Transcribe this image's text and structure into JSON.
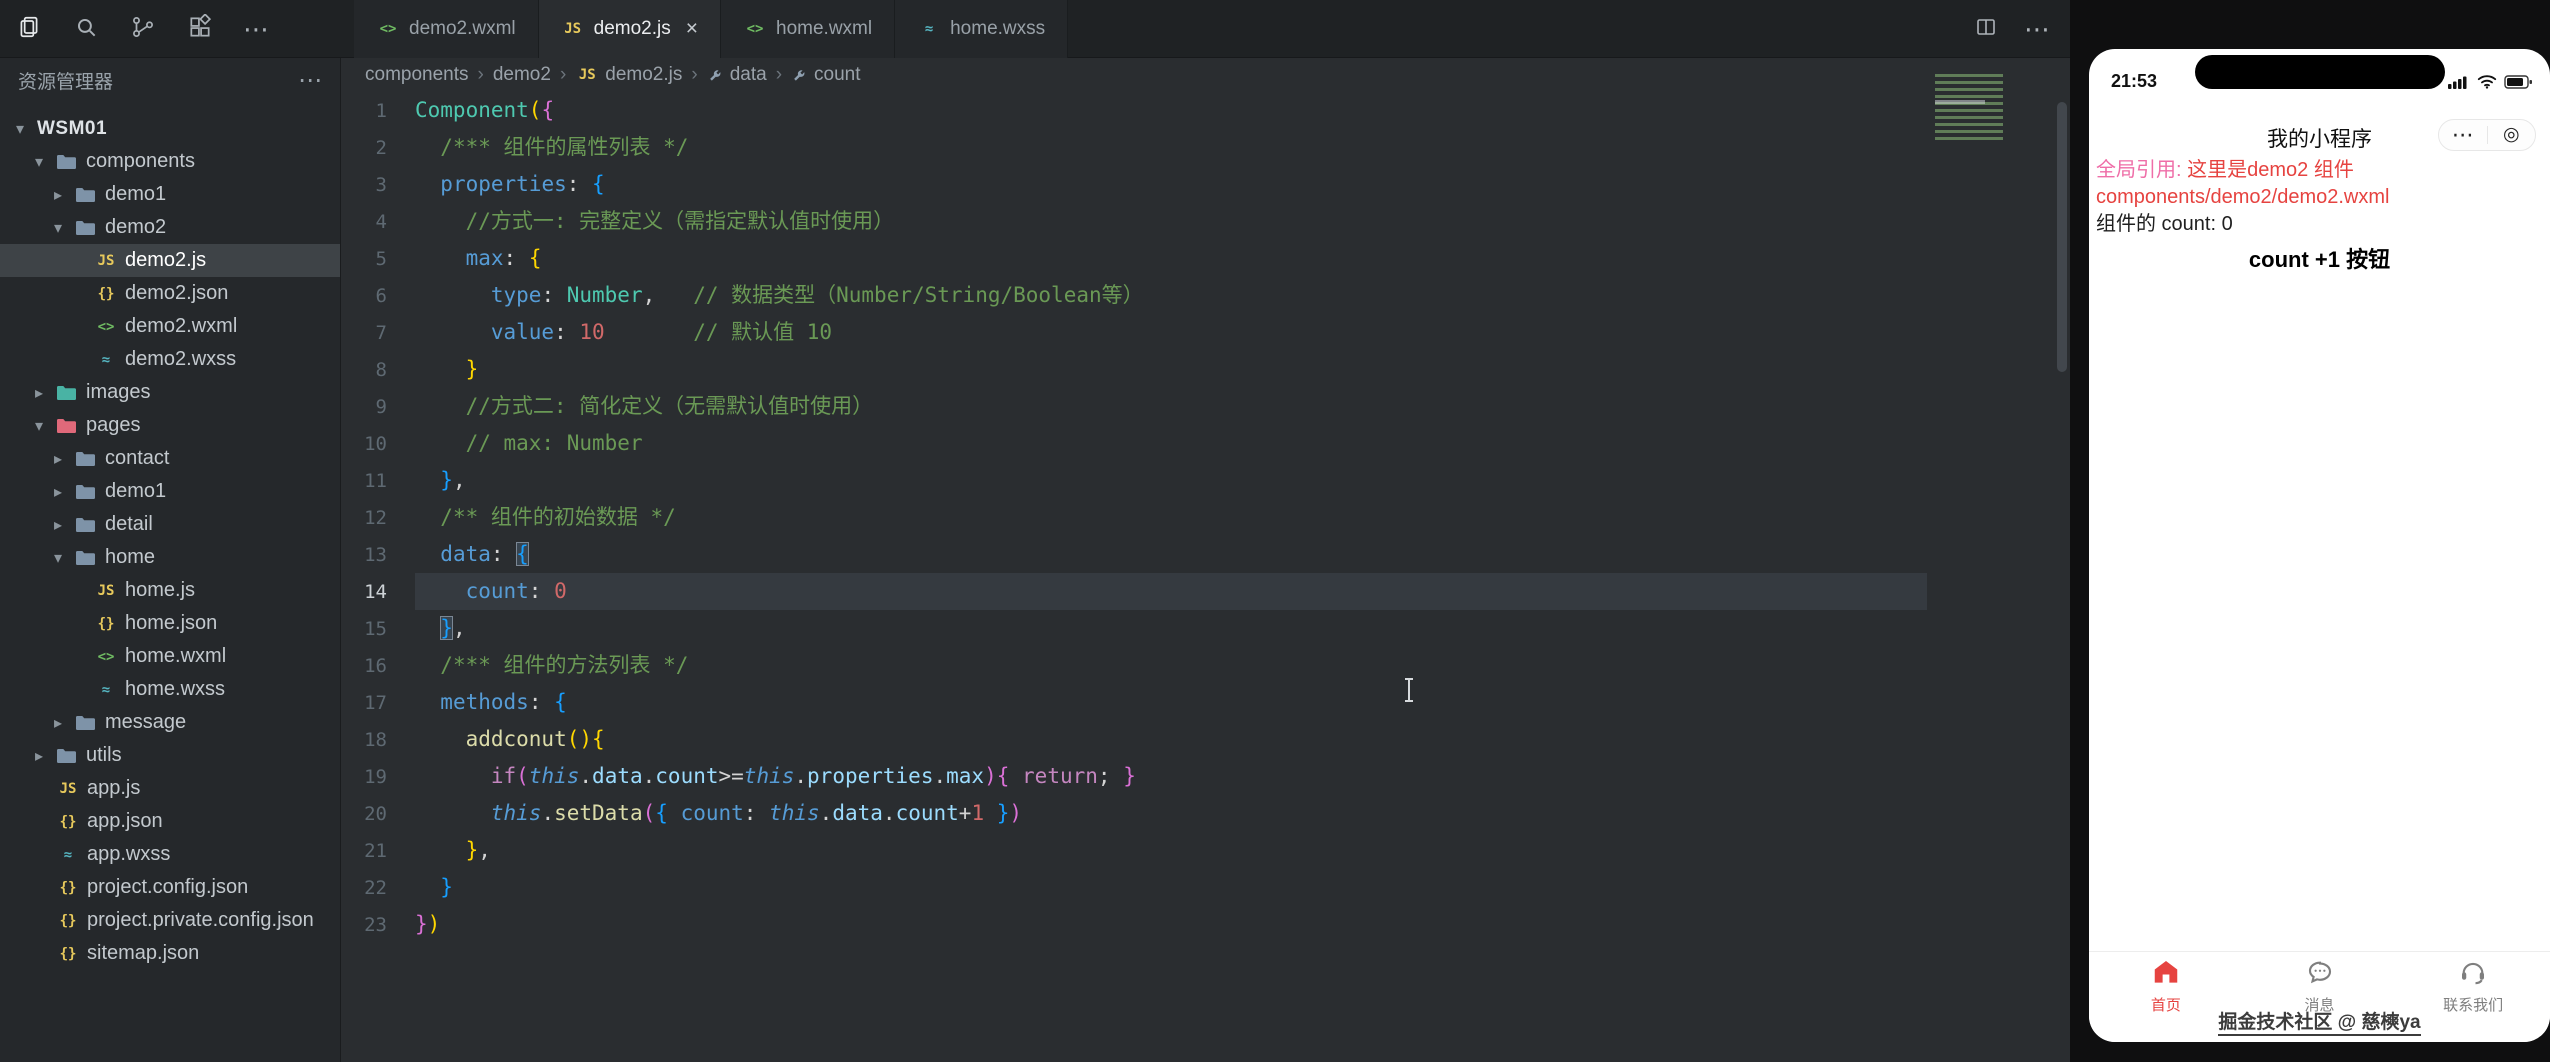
{
  "activity_bar": {
    "icons": [
      "files",
      "search",
      "git-graph",
      "extensions",
      "more"
    ],
    "more_glyph": "⋯"
  },
  "sidebar": {
    "title": "资源管理器",
    "more_label": "⋯",
    "chevron_open": "▾",
    "chevron_closed": "▸",
    "tree": [
      {
        "label": "WSM01",
        "depth": 0,
        "kind": "root",
        "state": "open"
      },
      {
        "label": "components",
        "depth": 1,
        "kind": "folder",
        "state": "open",
        "color": "#7e93a8"
      },
      {
        "label": "demo1",
        "depth": 2,
        "kind": "folder",
        "state": "closed",
        "color": "#7e93a8"
      },
      {
        "label": "demo2",
        "depth": 2,
        "kind": "folder",
        "state": "open",
        "color": "#7e93a8"
      },
      {
        "label": "demo2.js",
        "depth": 3,
        "kind": "file",
        "icon": "js",
        "selected": true
      },
      {
        "label": "demo2.json",
        "depth": 3,
        "kind": "file",
        "icon": "json"
      },
      {
        "label": "demo2.wxml",
        "depth": 3,
        "kind": "file",
        "icon": "wxml"
      },
      {
        "label": "demo2.wxss",
        "depth": 3,
        "kind": "file",
        "icon": "wxss"
      },
      {
        "label": "images",
        "depth": 1,
        "kind": "folder",
        "state": "closed",
        "color": "#49b3a4"
      },
      {
        "label": "pages",
        "depth": 1,
        "kind": "folder",
        "state": "open",
        "color": "#e0697a"
      },
      {
        "label": "contact",
        "depth": 2,
        "kind": "folder",
        "state": "closed",
        "color": "#7e93a8"
      },
      {
        "label": "demo1",
        "depth": 2,
        "kind": "folder",
        "state": "closed",
        "color": "#7e93a8"
      },
      {
        "label": "detail",
        "depth": 2,
        "kind": "folder",
        "state": "closed",
        "color": "#7e93a8"
      },
      {
        "label": "home",
        "depth": 2,
        "kind": "folder",
        "state": "open",
        "color": "#7e93a8"
      },
      {
        "label": "home.js",
        "depth": 3,
        "kind": "file",
        "icon": "js"
      },
      {
        "label": "home.json",
        "depth": 3,
        "kind": "file",
        "icon": "json"
      },
      {
        "label": "home.wxml",
        "depth": 3,
        "kind": "file",
        "icon": "wxml"
      },
      {
        "label": "home.wxss",
        "depth": 3,
        "kind": "file",
        "icon": "wxss"
      },
      {
        "label": "message",
        "depth": 2,
        "kind": "folder",
        "state": "closed",
        "color": "#7e93a8"
      },
      {
        "label": "utils",
        "depth": 1,
        "kind": "folder",
        "state": "closed",
        "color": "#7e93a8"
      },
      {
        "label": "app.js",
        "depth": 1,
        "kind": "file",
        "icon": "js"
      },
      {
        "label": "app.json",
        "depth": 1,
        "kind": "file",
        "icon": "json"
      },
      {
        "label": "app.wxss",
        "depth": 1,
        "kind": "file",
        "icon": "wxss"
      },
      {
        "label": "project.config.json",
        "depth": 1,
        "kind": "file",
        "icon": "json"
      },
      {
        "label": "project.private.config.json",
        "depth": 1,
        "kind": "file",
        "icon": "json"
      },
      {
        "label": "sitemap.json",
        "depth": 1,
        "kind": "file",
        "icon": "json"
      }
    ]
  },
  "file_icons": {
    "js": {
      "glyph": "JS",
      "color": "#e7c95c"
    },
    "json": {
      "glyph": "{}",
      "color": "#e7c95c"
    },
    "wxml": {
      "glyph": "<>",
      "color": "#6fba62"
    },
    "wxss": {
      "glyph": "≈",
      "color": "#56b6c2"
    }
  },
  "tabs": {
    "close_glyph": "×",
    "items": [
      {
        "label": "demo2.wxml",
        "icon": "wxml",
        "active": false
      },
      {
        "label": "demo2.js",
        "icon": "js",
        "active": true,
        "closable": true
      },
      {
        "label": "home.wxml",
        "icon": "wxml",
        "active": false
      },
      {
        "label": "home.wxss",
        "icon": "wxss",
        "active": false
      }
    ]
  },
  "editor_actions": {
    "icons": [
      "split-editor",
      "more"
    ],
    "more_glyph": "⋯"
  },
  "breadcrumb": {
    "separator": "›",
    "items": [
      {
        "label": "components"
      },
      {
        "label": "demo2"
      },
      {
        "label": "demo2.js",
        "icon": "js"
      },
      {
        "label": "data",
        "icon": "symbol"
      },
      {
        "label": "count",
        "icon": "symbol"
      }
    ]
  },
  "editor": {
    "active_line": 14,
    "lines": [
      [
        [
          "fn",
          "Component"
        ],
        [
          "b1",
          "("
        ],
        [
          "b2",
          "{"
        ]
      ],
      [
        [
          "ws",
          "  "
        ],
        [
          "c",
          "/*** 组件的属性列表 */"
        ]
      ],
      [
        [
          "ws",
          "  "
        ],
        [
          "key",
          "properties"
        ],
        [
          "pun",
          ": "
        ],
        [
          "b3",
          "{"
        ]
      ],
      [
        [
          "ws",
          "    "
        ],
        [
          "c",
          "//方式一: 完整定义（需指定默认值时使用）"
        ]
      ],
      [
        [
          "ws",
          "    "
        ],
        [
          "key",
          "max"
        ],
        [
          "pun",
          ": "
        ],
        [
          "b1",
          "{"
        ]
      ],
      [
        [
          "ws",
          "      "
        ],
        [
          "key",
          "type"
        ],
        [
          "pun",
          ": "
        ],
        [
          "type",
          "Number"
        ],
        [
          "pun",
          ","
        ],
        [
          "ws",
          "   "
        ],
        [
          "c",
          "// 数据类型（Number/String/Boolean等）"
        ]
      ],
      [
        [
          "ws",
          "      "
        ],
        [
          "key",
          "value"
        ],
        [
          "pun",
          ": "
        ],
        [
          "num",
          "10"
        ],
        [
          "ws",
          "       "
        ],
        [
          "c",
          "// 默认值 10"
        ]
      ],
      [
        [
          "ws",
          "    "
        ],
        [
          "b1",
          "}"
        ]
      ],
      [
        [
          "ws",
          "    "
        ],
        [
          "c",
          "//方式二: 简化定义（无需默认值时使用）"
        ]
      ],
      [
        [
          "ws",
          "    "
        ],
        [
          "c",
          "// max: Number"
        ]
      ],
      [
        [
          "ws",
          "  "
        ],
        [
          "b3",
          "}"
        ],
        [
          "pun",
          ","
        ]
      ],
      [
        [
          "ws",
          "  "
        ],
        [
          "c",
          "/** 组件的初始数据 */"
        ]
      ],
      [
        [
          "ws",
          "  "
        ],
        [
          "key",
          "data"
        ],
        [
          "pun",
          ": "
        ],
        [
          "b3m",
          "{"
        ]
      ],
      [
        [
          "ws",
          "    "
        ],
        [
          "key",
          "count"
        ],
        [
          "pun",
          ": "
        ],
        [
          "num",
          "0"
        ]
      ],
      [
        [
          "ws",
          "  "
        ],
        [
          "b3m",
          "}"
        ],
        [
          "pun",
          ","
        ]
      ],
      [
        [
          "ws",
          "  "
        ],
        [
          "c",
          "/*** 组件的方法列表 */"
        ]
      ],
      [
        [
          "ws",
          "  "
        ],
        [
          "key",
          "methods"
        ],
        [
          "pun",
          ": "
        ],
        [
          "b3",
          "{"
        ]
      ],
      [
        [
          "ws",
          "    "
        ],
        [
          "fn2",
          "addconut"
        ],
        [
          "b1",
          "("
        ],
        [
          "b1",
          ")"
        ],
        [
          "b1",
          "{"
        ]
      ],
      [
        [
          "ws",
          "      "
        ],
        [
          "kw",
          "if"
        ],
        [
          "b2",
          "("
        ],
        [
          "this",
          "this"
        ],
        [
          "pun",
          "."
        ],
        [
          "mem",
          "data"
        ],
        [
          "pun",
          "."
        ],
        [
          "mem",
          "count"
        ],
        [
          "op",
          ">="
        ],
        [
          "this",
          "this"
        ],
        [
          "pun",
          "."
        ],
        [
          "mem",
          "properties"
        ],
        [
          "pun",
          "."
        ],
        [
          "mem",
          "max"
        ],
        [
          "b2",
          ")"
        ],
        [
          "b2",
          "{"
        ],
        [
          "ws",
          " "
        ],
        [
          "kw",
          "return"
        ],
        [
          "pun",
          "; "
        ],
        [
          "b2",
          "}"
        ]
      ],
      [
        [
          "ws",
          "      "
        ],
        [
          "this",
          "this"
        ],
        [
          "pun",
          "."
        ],
        [
          "fn2",
          "setData"
        ],
        [
          "b2",
          "("
        ],
        [
          "b3",
          "{"
        ],
        [
          "ws",
          " "
        ],
        [
          "key",
          "count"
        ],
        [
          "pun",
          ": "
        ],
        [
          "this",
          "this"
        ],
        [
          "pun",
          "."
        ],
        [
          "mem",
          "data"
        ],
        [
          "pun",
          "."
        ],
        [
          "mem",
          "count"
        ],
        [
          "op",
          "+"
        ],
        [
          "num",
          "1"
        ],
        [
          "ws",
          " "
        ],
        [
          "b3",
          "}"
        ],
        [
          "b2",
          ")"
        ]
      ],
      [
        [
          "ws",
          "    "
        ],
        [
          "b1",
          "}"
        ],
        [
          "pun",
          ","
        ]
      ],
      [
        [
          "ws",
          "  "
        ],
        [
          "b3",
          "}"
        ]
      ],
      [
        [
          "b2",
          "}"
        ],
        [
          "b1",
          ")"
        ]
      ]
    ]
  },
  "simulator": {
    "time": "21:53",
    "nav_title": "我的小程序",
    "capsule": {
      "more": "⋯",
      "indicator": "◎"
    },
    "content": [
      [
        {
          "text": "全局引用: ",
          "color": "#ef6ea8"
        },
        {
          "text": "这里是demo2 组件",
          "color": "#e64340"
        }
      ],
      [
        {
          "text": "components/demo2/demo2.wxml",
          "color": "#e64340"
        }
      ],
      [
        {
          "text": "组件的 count: 0",
          "color": "#1f1f1f"
        }
      ]
    ],
    "button_label": "count +1 按钮",
    "tabbar": [
      {
        "label": "首页",
        "icon": "home",
        "color": "#e64340",
        "active": true
      },
      {
        "label": "消息",
        "icon": "message",
        "color": "#7f7f7f",
        "active": false
      },
      {
        "label": "联系我们",
        "icon": "contact",
        "color": "#7f7f7f",
        "active": false
      }
    ],
    "watermark": "掘金技术社区 @ 慈樉ya"
  }
}
